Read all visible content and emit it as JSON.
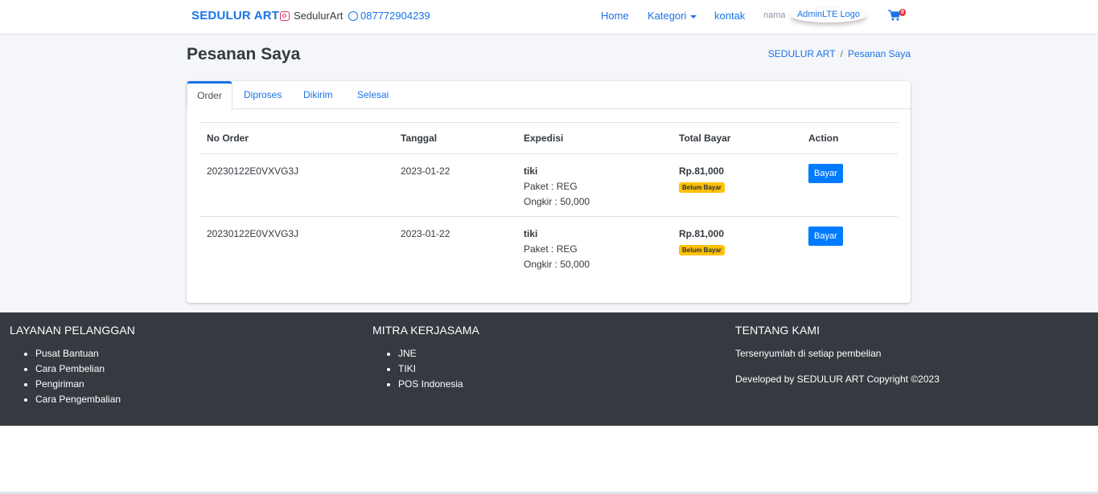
{
  "navbar": {
    "brand": "SEDULUR ART",
    "instagram": "SedulurArt",
    "whatsapp": "087772904239",
    "links": [
      "Home",
      "Kategori",
      "kontak"
    ],
    "user_name": "nama",
    "logo_alt": "AdminLTE Logo",
    "cart_count": "0"
  },
  "page": {
    "title": "Pesanan Saya",
    "breadcrumb": [
      "SEDULUR ART",
      "Pesanan Saya"
    ]
  },
  "tabs": [
    "Order",
    "Diproses",
    "Dikirim",
    "Selesai"
  ],
  "table": {
    "headers": [
      "No Order",
      "Tanggal",
      "Expedisi",
      "Total Bayar",
      "Action"
    ],
    "rows": [
      {
        "no_order": "20230122E0VXVG3J",
        "tanggal": "2023-01-22",
        "expedisi": "tiki",
        "paket": "Paket : REG",
        "ongkir": "Ongkir : 50,000",
        "total": "Rp.81,000",
        "status": "Belum Bayar",
        "action": "Bayar"
      },
      {
        "no_order": "20230122E0VXVG3J",
        "tanggal": "2023-01-22",
        "expedisi": "tiki",
        "paket": "Paket : REG",
        "ongkir": "Ongkir : 50,000",
        "total": "Rp.81,000",
        "status": "Belum Bayar",
        "action": "Bayar"
      }
    ]
  },
  "footer": {
    "layanan": {
      "title": "LAYANAN PELANGGAN",
      "items": [
        "Pusat Bantuan",
        "Cara Pembelian",
        "Pengiriman",
        "Cara Pengembalian"
      ]
    },
    "mitra": {
      "title": "MITRA KERJASAMA",
      "items": [
        "JNE",
        "TIKI",
        "POS Indonesia"
      ]
    },
    "tentang": {
      "title": "TENTANG KAMI",
      "text1": "Tersenyumlah di setiap pembelian",
      "text2": "Developed by SEDULUR ART Copyright ©2023"
    }
  },
  "colors": {
    "accent": "#1a73e8",
    "button": "#007bff",
    "badge": "#ffc107",
    "footer_bg": "#343a40",
    "content_bg": "#f4f6f9"
  }
}
